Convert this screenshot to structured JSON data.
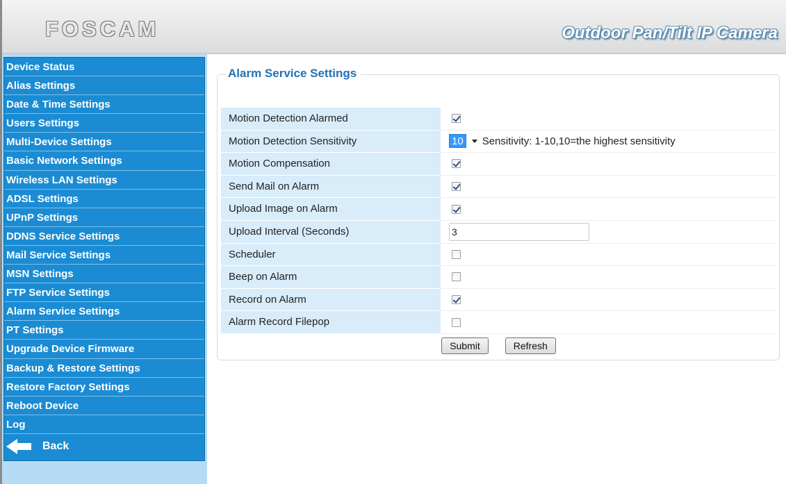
{
  "header": {
    "logo": "FOSCAM",
    "product_title": "Outdoor Pan/Tilt IP Camera"
  },
  "sidebar": {
    "items": [
      {
        "label": "Device Status"
      },
      {
        "label": "Alias Settings"
      },
      {
        "label": "Date & Time Settings"
      },
      {
        "label": "Users Settings"
      },
      {
        "label": "Multi-Device Settings"
      },
      {
        "label": "Basic Network Settings"
      },
      {
        "label": "Wireless LAN Settings"
      },
      {
        "label": "ADSL Settings"
      },
      {
        "label": "UPnP Settings"
      },
      {
        "label": "DDNS Service Settings"
      },
      {
        "label": "Mail Service Settings"
      },
      {
        "label": "MSN Settings"
      },
      {
        "label": "FTP Service Settings"
      },
      {
        "label": "Alarm Service Settings"
      },
      {
        "label": "PT Settings"
      },
      {
        "label": "Upgrade Device Firmware"
      },
      {
        "label": "Backup & Restore Settings"
      },
      {
        "label": "Restore Factory Settings"
      },
      {
        "label": "Reboot Device"
      },
      {
        "label": "Log"
      }
    ],
    "back_label": "Back",
    "back_icon": "arrow-left-icon"
  },
  "main": {
    "section_title": "Alarm Service Settings",
    "rows": [
      {
        "label": "Motion Detection Alarmed",
        "checked": true
      },
      {
        "label": "Motion Detection Sensitivity",
        "select_value": "10",
        "hint": "Sensitivity: 1-10,10=the highest sensitivity"
      },
      {
        "label": "Motion Compensation",
        "checked": true
      },
      {
        "label": "Send Mail on Alarm",
        "checked": true
      },
      {
        "label": "Upload Image on Alarm",
        "checked": true
      },
      {
        "label": "Upload Interval (Seconds)",
        "input_value": "3"
      },
      {
        "label": "Scheduler",
        "checked": false
      },
      {
        "label": "Beep on Alarm",
        "checked": false
      },
      {
        "label": "Record on Alarm",
        "checked": true
      },
      {
        "label": "Alarm Record Filepop",
        "checked": false
      }
    ],
    "submit_label": "Submit",
    "refresh_label": "Refresh"
  },
  "colors": {
    "sidebar": "#1b8cd3",
    "sidebar_bg": "#b6dcf5",
    "label_cell": "#d8ecf9",
    "title": "#2172b5"
  }
}
